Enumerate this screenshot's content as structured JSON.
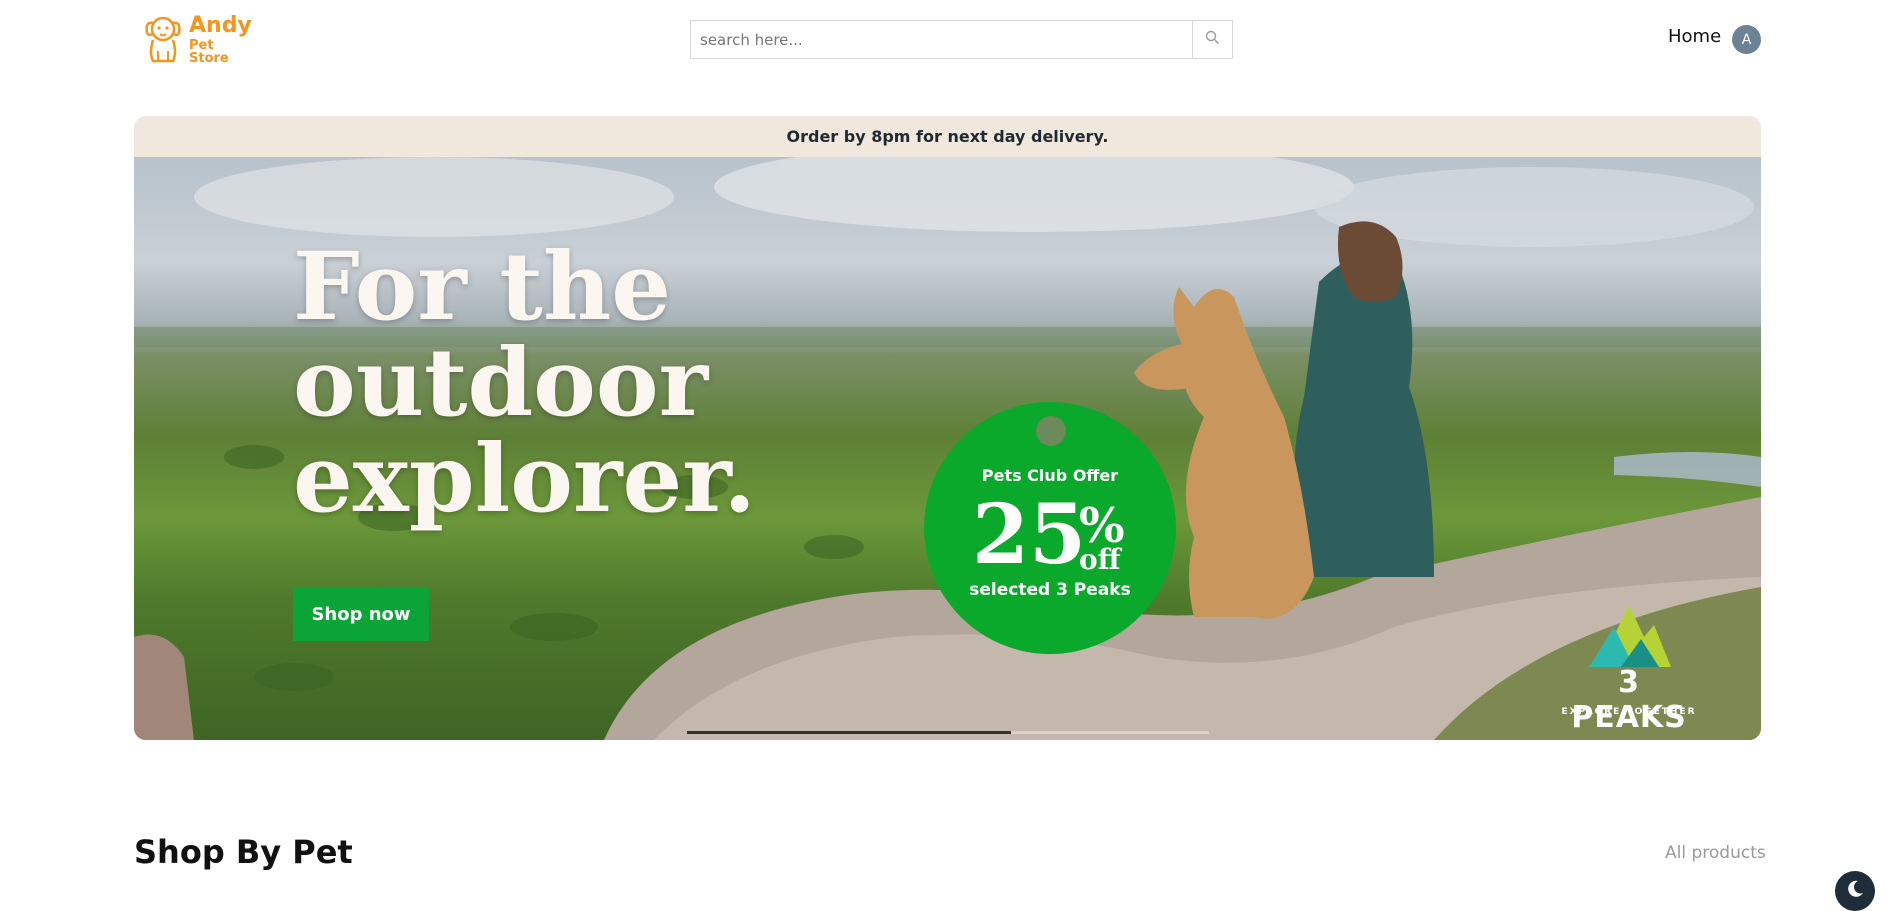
{
  "header": {
    "logo": {
      "name": "Andy",
      "sub": "Pet Store",
      "icon": "dog-icon"
    },
    "search": {
      "placeholder": "search here...",
      "value": "",
      "icon": "search-icon"
    },
    "nav": {
      "home_label": "Home"
    },
    "avatar_letter": "A"
  },
  "hero": {
    "strip_text": "Order by 8pm for next day delivery.",
    "headline": [
      "For the",
      "outdoor",
      "explorer."
    ],
    "cta_label": "Shop now",
    "offer": {
      "title": "Pets Club Offer",
      "percent": "25",
      "symbol": "%",
      "off": "off",
      "subtitle": "selected 3 Peaks"
    },
    "brand": {
      "name": "3 PEAKS",
      "tagline": "EXPLORE TOGETHER"
    },
    "slide_progress": 0.62,
    "colors": {
      "strip_bg": "#f0e7dd",
      "cta": "#0aa437",
      "offer": "#0aa82b"
    }
  },
  "section": {
    "title": "Shop By Pet",
    "all_products_label": "All products"
  },
  "theme_toggle_icon": "moon-icon",
  "colors": {
    "brand": "#f7941d"
  }
}
